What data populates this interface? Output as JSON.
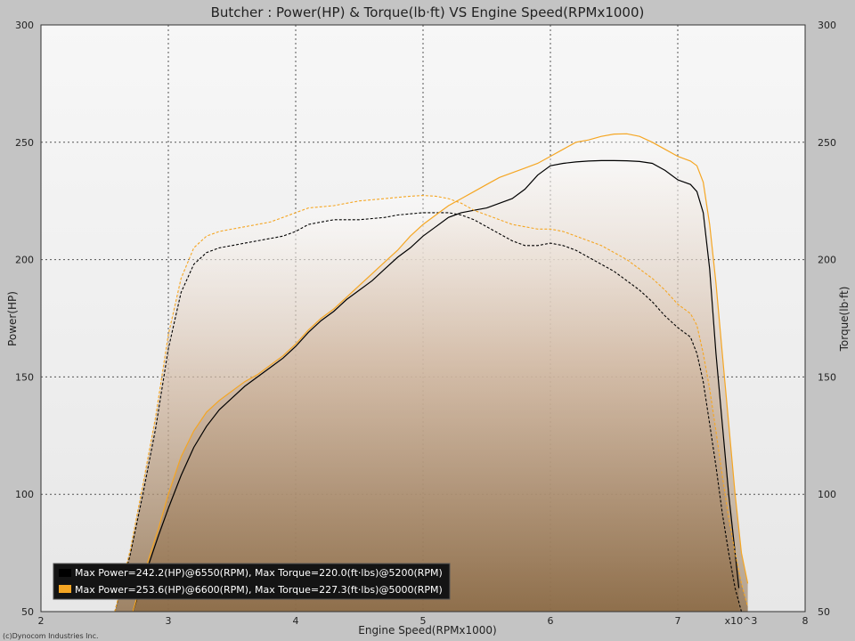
{
  "chart_data": {
    "type": "line",
    "title": "Butcher : Power(HP) & Torque(lb·ft) VS Engine Speed(RPMx1000)",
    "xlabel": "Engine Speed(RPMx1000)",
    "ylabel_left": "Power(HP)",
    "ylabel_right": "Torque(lb·ft)",
    "x_multiplier_label": "x10^3",
    "xlim": [
      2,
      8
    ],
    "ylim": [
      50,
      300
    ],
    "x_ticks": [
      "2",
      "3",
      "4",
      "5",
      "6",
      "7",
      "8"
    ],
    "y_ticks_left": [
      "300",
      "250",
      "200",
      "150",
      "100",
      "50"
    ],
    "y_ticks_right": [
      "300",
      "250",
      "200",
      "150",
      "100",
      "50"
    ],
    "grid": true,
    "legend_position": "bottom-left",
    "copyright": "(c)Dynocom Industries Inc.",
    "series": [
      {
        "name": "Max Power=242.2(HP)@6550(RPM), Max Torque=220.0(ft·lbs)@5200(RPM)",
        "color": "#000000",
        "power": [
          [
            2.72,
            50
          ],
          [
            2.82,
            66
          ],
          [
            2.92,
            82
          ],
          [
            3.0,
            94
          ],
          [
            3.1,
            108
          ],
          [
            3.2,
            120
          ],
          [
            3.3,
            129
          ],
          [
            3.4,
            136
          ],
          [
            3.5,
            141
          ],
          [
            3.6,
            146
          ],
          [
            3.7,
            150
          ],
          [
            3.8,
            154
          ],
          [
            3.9,
            158
          ],
          [
            4.0,
            163
          ],
          [
            4.1,
            169
          ],
          [
            4.2,
            174
          ],
          [
            4.3,
            178
          ],
          [
            4.4,
            183
          ],
          [
            4.5,
            187
          ],
          [
            4.6,
            191
          ],
          [
            4.7,
            196
          ],
          [
            4.8,
            201
          ],
          [
            4.9,
            205
          ],
          [
            5.0,
            210
          ],
          [
            5.1,
            214
          ],
          [
            5.2,
            218
          ],
          [
            5.3,
            220
          ],
          [
            5.4,
            221
          ],
          [
            5.5,
            222
          ],
          [
            5.6,
            224
          ],
          [
            5.7,
            226
          ],
          [
            5.8,
            230
          ],
          [
            5.9,
            236
          ],
          [
            6.0,
            240
          ],
          [
            6.1,
            241
          ],
          [
            6.2,
            241.6
          ],
          [
            6.3,
            242
          ],
          [
            6.4,
            242.2
          ],
          [
            6.5,
            242.2
          ],
          [
            6.6,
            242.1
          ],
          [
            6.7,
            241.8
          ],
          [
            6.8,
            241
          ],
          [
            6.9,
            238
          ],
          [
            7.0,
            234
          ],
          [
            7.1,
            232
          ],
          [
            7.15,
            229
          ],
          [
            7.2,
            220
          ],
          [
            7.25,
            196
          ],
          [
            7.3,
            160
          ],
          [
            7.35,
            130
          ],
          [
            7.4,
            100
          ],
          [
            7.45,
            75
          ],
          [
            7.48,
            60
          ]
        ],
        "torque": [
          [
            2.58,
            50
          ],
          [
            2.7,
            74
          ],
          [
            2.8,
            100
          ],
          [
            2.9,
            128
          ],
          [
            3.0,
            162
          ],
          [
            3.1,
            186
          ],
          [
            3.2,
            198
          ],
          [
            3.3,
            203
          ],
          [
            3.4,
            205
          ],
          [
            3.5,
            206
          ],
          [
            3.6,
            207
          ],
          [
            3.7,
            208
          ],
          [
            3.8,
            209
          ],
          [
            3.9,
            210
          ],
          [
            4.0,
            212
          ],
          [
            4.1,
            215
          ],
          [
            4.2,
            216
          ],
          [
            4.3,
            217
          ],
          [
            4.4,
            217
          ],
          [
            4.5,
            217
          ],
          [
            4.6,
            217.5
          ],
          [
            4.7,
            218
          ],
          [
            4.8,
            219
          ],
          [
            4.9,
            219.5
          ],
          [
            5.0,
            220
          ],
          [
            5.1,
            220
          ],
          [
            5.2,
            220
          ],
          [
            5.3,
            219
          ],
          [
            5.4,
            217
          ],
          [
            5.5,
            214
          ],
          [
            5.6,
            211
          ],
          [
            5.7,
            208
          ],
          [
            5.8,
            206
          ],
          [
            5.9,
            206
          ],
          [
            6.0,
            207
          ],
          [
            6.1,
            206
          ],
          [
            6.2,
            204
          ],
          [
            6.3,
            201
          ],
          [
            6.4,
            198
          ],
          [
            6.5,
            195
          ],
          [
            6.6,
            191
          ],
          [
            6.7,
            187
          ],
          [
            6.8,
            182
          ],
          [
            6.9,
            176
          ],
          [
            7.0,
            171
          ],
          [
            7.1,
            167
          ],
          [
            7.15,
            160
          ],
          [
            7.2,
            148
          ],
          [
            7.25,
            130
          ],
          [
            7.3,
            112
          ],
          [
            7.35,
            92
          ],
          [
            7.4,
            75
          ],
          [
            7.45,
            60
          ],
          [
            7.5,
            50
          ]
        ]
      },
      {
        "name": "Max Power=253.6(HP)@6600(RPM), Max Torque=227.3(ft·lbs)@5000(RPM)",
        "color": "#f5a623",
        "power": [
          [
            2.72,
            50
          ],
          [
            2.82,
            68
          ],
          [
            2.92,
            85
          ],
          [
            3.0,
            100
          ],
          [
            3.1,
            116
          ],
          [
            3.2,
            127
          ],
          [
            3.3,
            135
          ],
          [
            3.4,
            140
          ],
          [
            3.5,
            144
          ],
          [
            3.6,
            148
          ],
          [
            3.7,
            151
          ],
          [
            3.8,
            155
          ],
          [
            3.9,
            159
          ],
          [
            4.0,
            164
          ],
          [
            4.1,
            170
          ],
          [
            4.2,
            175
          ],
          [
            4.3,
            179
          ],
          [
            4.4,
            184
          ],
          [
            4.5,
            189
          ],
          [
            4.6,
            194
          ],
          [
            4.7,
            199
          ],
          [
            4.8,
            204
          ],
          [
            4.9,
            210
          ],
          [
            5.0,
            215
          ],
          [
            5.1,
            219
          ],
          [
            5.2,
            223
          ],
          [
            5.3,
            226
          ],
          [
            5.4,
            229
          ],
          [
            5.5,
            232
          ],
          [
            5.6,
            235
          ],
          [
            5.7,
            237
          ],
          [
            5.8,
            239
          ],
          [
            5.9,
            241
          ],
          [
            6.0,
            244
          ],
          [
            6.1,
            247
          ],
          [
            6.2,
            250
          ],
          [
            6.3,
            251
          ],
          [
            6.4,
            252.5
          ],
          [
            6.5,
            253.5
          ],
          [
            6.6,
            253.6
          ],
          [
            6.7,
            252.5
          ],
          [
            6.8,
            250
          ],
          [
            6.9,
            247
          ],
          [
            7.0,
            244
          ],
          [
            7.1,
            242
          ],
          [
            7.15,
            240
          ],
          [
            7.2,
            233
          ],
          [
            7.25,
            215
          ],
          [
            7.3,
            190
          ],
          [
            7.35,
            160
          ],
          [
            7.4,
            130
          ],
          [
            7.45,
            100
          ],
          [
            7.5,
            75
          ],
          [
            7.55,
            62
          ]
        ],
        "torque": [
          [
            2.58,
            50
          ],
          [
            2.7,
            76
          ],
          [
            2.8,
            104
          ],
          [
            2.9,
            133
          ],
          [
            3.0,
            168
          ],
          [
            3.1,
            192
          ],
          [
            3.2,
            205
          ],
          [
            3.3,
            210
          ],
          [
            3.4,
            212
          ],
          [
            3.5,
            213
          ],
          [
            3.6,
            214
          ],
          [
            3.7,
            215
          ],
          [
            3.8,
            216
          ],
          [
            3.9,
            218
          ],
          [
            4.0,
            220
          ],
          [
            4.1,
            222
          ],
          [
            4.2,
            222.5
          ],
          [
            4.3,
            223
          ],
          [
            4.4,
            224
          ],
          [
            4.5,
            225
          ],
          [
            4.6,
            225.5
          ],
          [
            4.7,
            226
          ],
          [
            4.8,
            226.5
          ],
          [
            4.9,
            227
          ],
          [
            5.0,
            227.3
          ],
          [
            5.1,
            227
          ],
          [
            5.2,
            226
          ],
          [
            5.3,
            224
          ],
          [
            5.4,
            221
          ],
          [
            5.5,
            219
          ],
          [
            5.6,
            217
          ],
          [
            5.7,
            215
          ],
          [
            5.8,
            214
          ],
          [
            5.9,
            213
          ],
          [
            6.0,
            213
          ],
          [
            6.1,
            212
          ],
          [
            6.2,
            210
          ],
          [
            6.3,
            208
          ],
          [
            6.4,
            206
          ],
          [
            6.5,
            203
          ],
          [
            6.6,
            200
          ],
          [
            6.7,
            196
          ],
          [
            6.8,
            192
          ],
          [
            6.9,
            187
          ],
          [
            7.0,
            181
          ],
          [
            7.1,
            177
          ],
          [
            7.15,
            172
          ],
          [
            7.2,
            160
          ],
          [
            7.25,
            145
          ],
          [
            7.3,
            127
          ],
          [
            7.35,
            108
          ],
          [
            7.4,
            90
          ],
          [
            7.45,
            75
          ],
          [
            7.5,
            62
          ],
          [
            7.55,
            52
          ]
        ]
      }
    ]
  }
}
